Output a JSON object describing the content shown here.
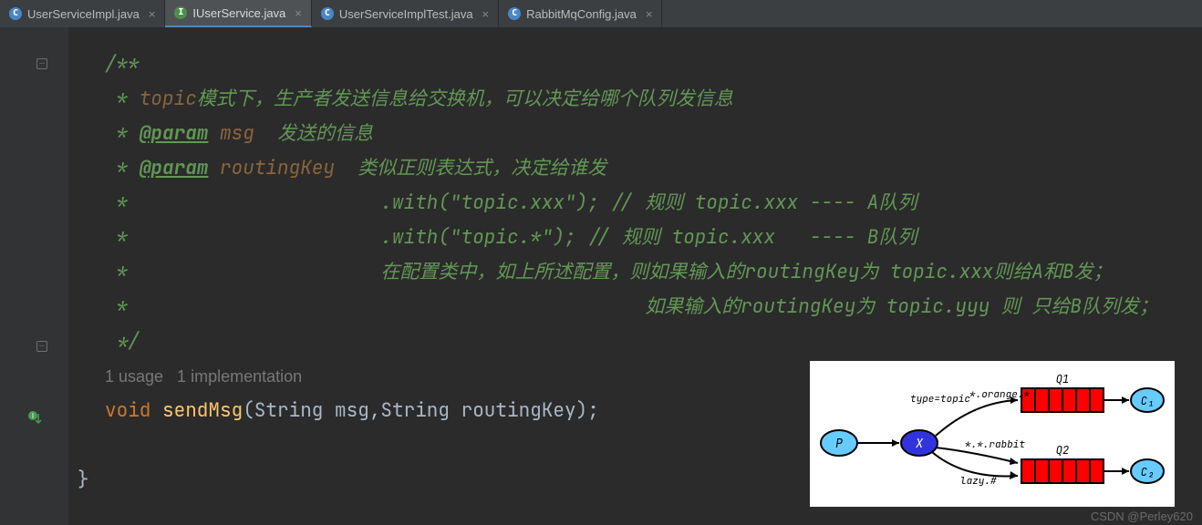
{
  "tabs": [
    {
      "label": "UserServiceImpl.java",
      "icon": "c",
      "active": false
    },
    {
      "label": "IUserService.java",
      "icon": "i",
      "active": true
    },
    {
      "label": "UserServiceImplTest.java",
      "icon": "c",
      "active": false
    },
    {
      "label": "RabbitMqConfig.java",
      "icon": "c",
      "active": false
    }
  ],
  "code": {
    "doc_open": "/**",
    "l1_pre": " * ",
    "l1_kw": "topic",
    "l1_rest": "模式下，生产者发送信息给交换机，可以决定给哪个队列发信息",
    "l2_pre": " * ",
    "l2_tag": "@param",
    "l2_name": " msg",
    "l2_rest": "  发送的信息",
    "l3_pre": " * ",
    "l3_tag": "@param",
    "l3_name": " routingKey",
    "l3_rest": "  类似正则表达式，决定给谁发",
    "l4": " *                      .with(\"topic.xxx\"); // 规则 topic.xxx ---- A队列",
    "l5": " *                      .with(\"topic.*\"); // 规则 topic.xxx   ---- B队列",
    "l6": " *                      在配置类中，如上所述配置，则如果输入的routingKey为 topic.xxx则给A和B发；",
    "l7": " *                                             如果输入的routingKey为 topic.yyy 则 只给B队列发；",
    "doc_close": " */",
    "hints": "1 usage   1 implementation",
    "sig_kw": "void ",
    "sig_name": "sendMsg",
    "sig_args": "(String msg,String routingKey);",
    "brace": "}"
  },
  "diagram": {
    "p": "P",
    "x": "X",
    "c1": "C₁",
    "c2": "C₂",
    "q1": "Q1",
    "q2": "Q2",
    "type": "type=topic",
    "r1": "*.orange.*",
    "r2": "*.*.rabbit",
    "r3": "lazy.#"
  },
  "watermark": "CSDN @Perley620"
}
